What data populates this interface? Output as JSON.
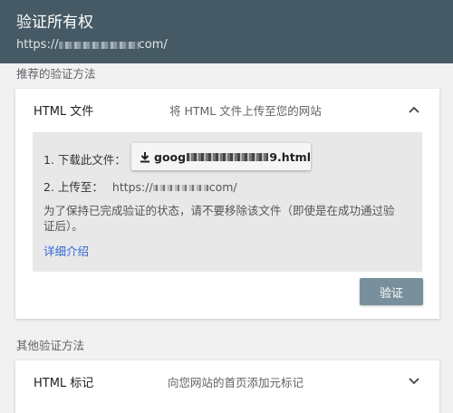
{
  "header": {
    "title": "验证所有权",
    "url_prefix": "https://",
    "url_suffix": "com/"
  },
  "recommended": {
    "label": "推荐的验证方法",
    "card": {
      "title": "HTML 文件",
      "description": "将 HTML 文件上传至您的网站",
      "step1_label": "1. 下载此文件：",
      "download_prefix": "goog",
      "download_suffix": "9.html",
      "step2_label": "2. 上传至：",
      "upload_prefix": "https://",
      "upload_suffix": "com/",
      "note": "为了保持已完成验证的状态，请不要移除该文件（即使是在成功通过验证后）。",
      "details_link": "详细介绍",
      "verify_button": "验证"
    }
  },
  "other": {
    "label": "其他验证方法",
    "card": {
      "title": "HTML 标记",
      "description": "向您网站的首页添加元标记"
    }
  },
  "colors": {
    "header_bg": "#455a64",
    "verify_button_bg": "#78909c",
    "link": "#3367d6"
  },
  "icons": [
    "chevron-up-icon",
    "download-icon",
    "chevron-down-icon"
  ]
}
